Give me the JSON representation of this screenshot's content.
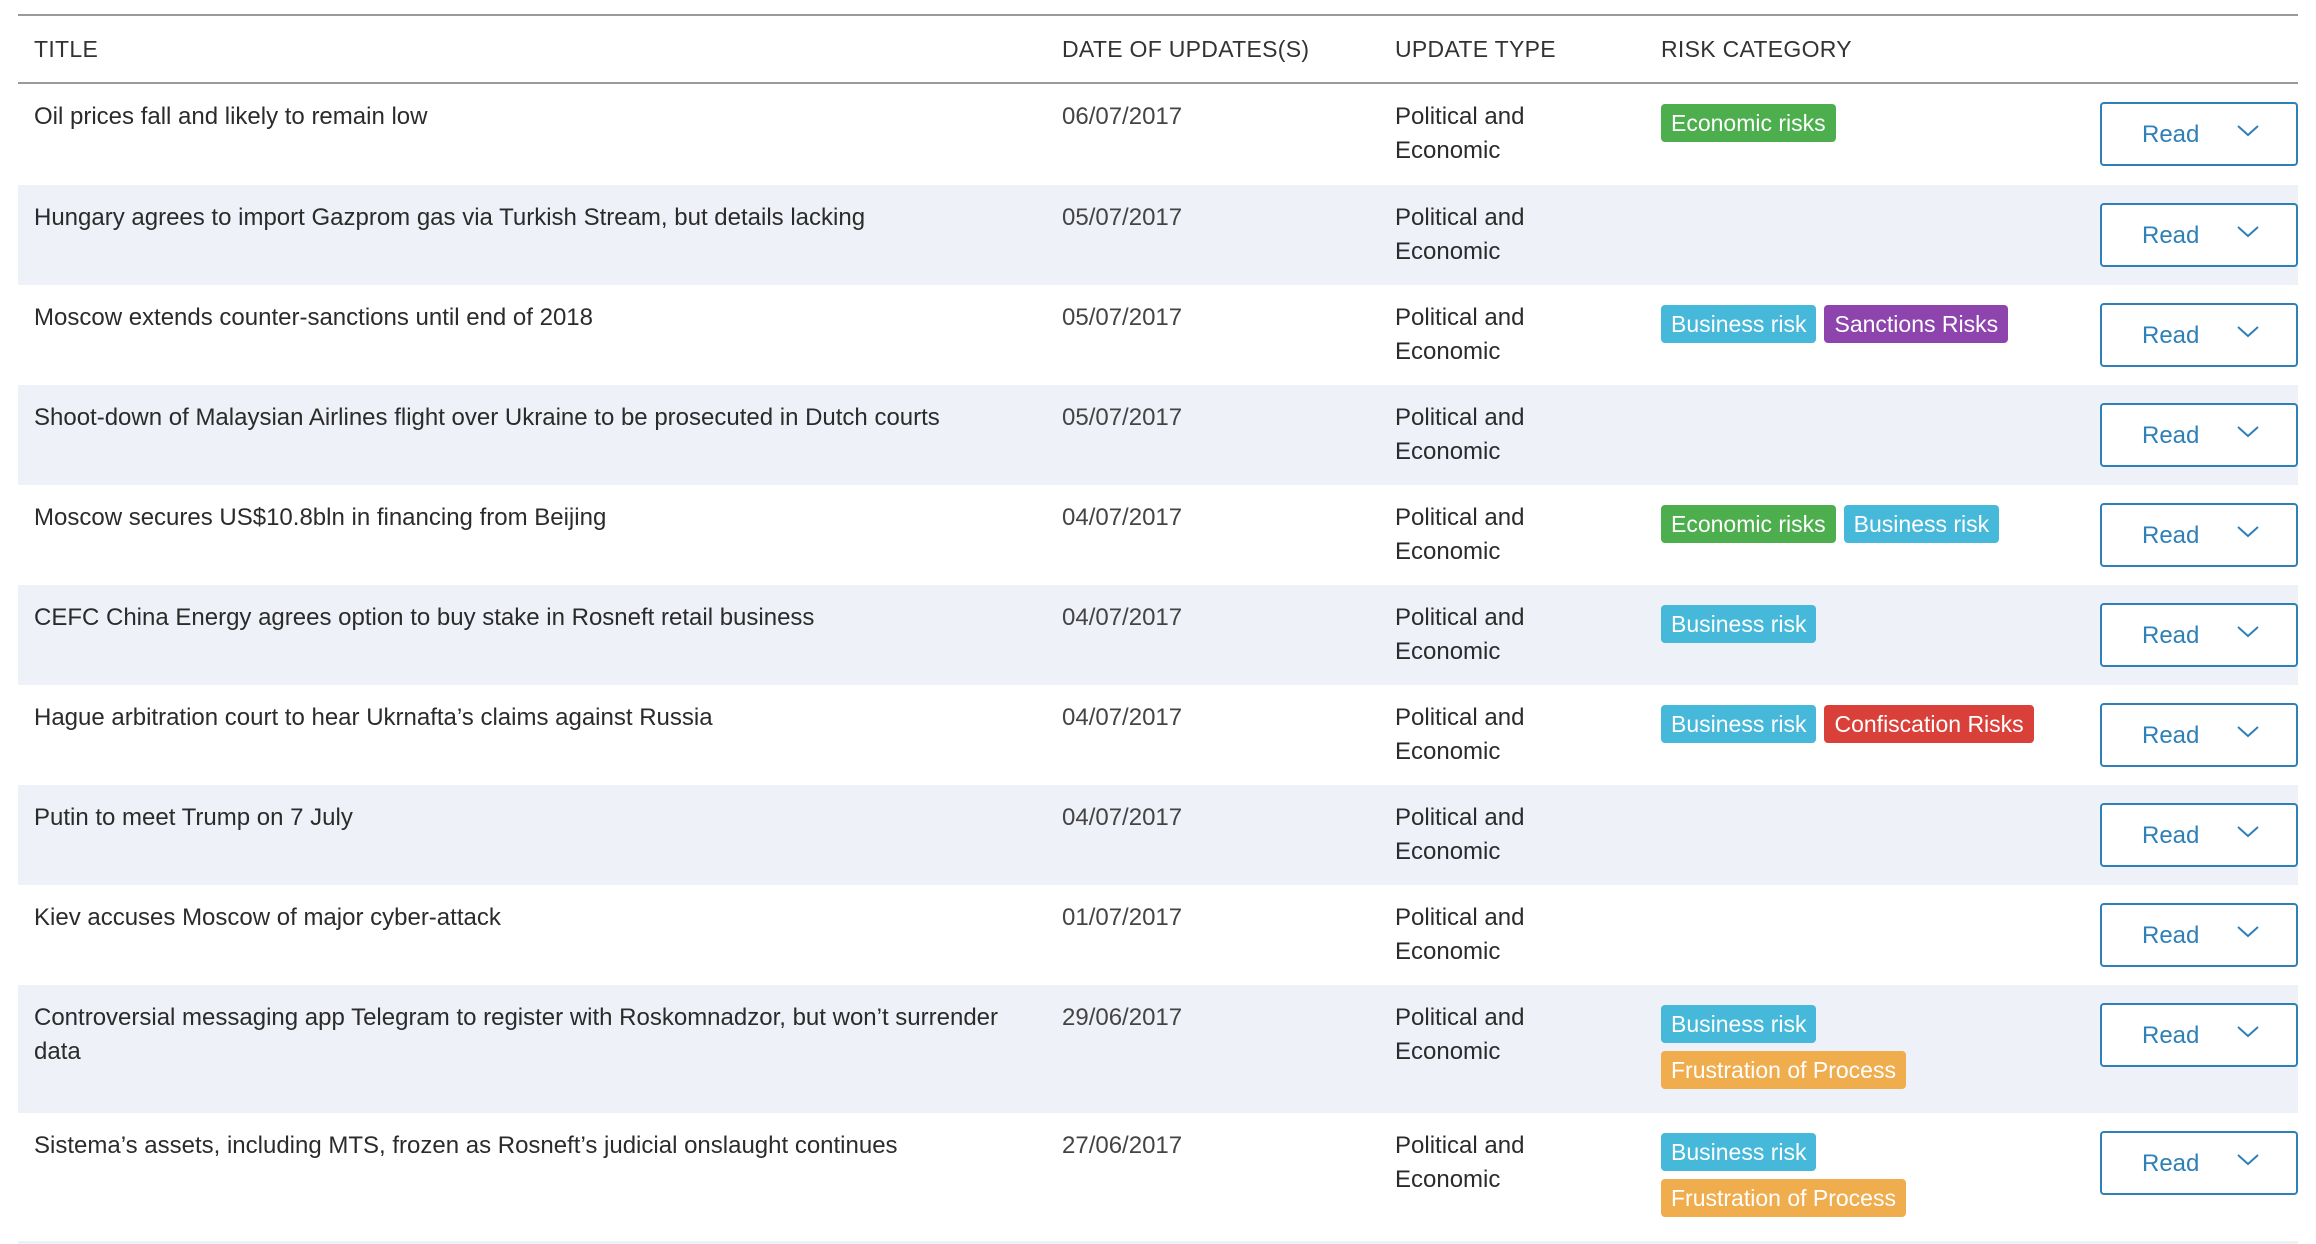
{
  "headers": {
    "title": "TITLE",
    "date": "DATE OF UPDATES(S)",
    "type": "UPDATE TYPE",
    "risk": "RISK CATEGORY"
  },
  "read_label": "Read",
  "tag_colors": {
    "Economic risks": "#4cae4c",
    "Business risk": "#46b8da",
    "Sanctions Risks": "#8e44ad",
    "Confiscation Risks": "#d9403a",
    "Frustration of Process": "#f0ad4e"
  },
  "rows": [
    {
      "title": "Oil prices fall and likely to remain low",
      "date": "06/07/2017",
      "type": "Political and Economic",
      "tags": [
        "Economic risks"
      ]
    },
    {
      "title": "Hungary agrees to import Gazprom gas via Turkish Stream, but details lacking",
      "date": "05/07/2017",
      "type": "Political and Economic",
      "tags": []
    },
    {
      "title": "Moscow extends counter-sanctions until end of 2018",
      "date": "05/07/2017",
      "type": "Political and Economic",
      "tags": [
        "Business risk",
        "Sanctions Risks"
      ]
    },
    {
      "title": "Shoot-down of Malaysian Airlines flight over Ukraine to be prosecuted in Dutch courts",
      "date": "05/07/2017",
      "type": "Political and Economic",
      "tags": []
    },
    {
      "title": "Moscow secures US$10.8bln in financing from Beijing",
      "date": "04/07/2017",
      "type": "Political and Economic",
      "tags": [
        "Economic risks",
        "Business risk"
      ]
    },
    {
      "title": "CEFC China Energy agrees option to buy stake in Rosneft retail business",
      "date": "04/07/2017",
      "type": "Political and Economic",
      "tags": [
        "Business risk"
      ]
    },
    {
      "title": "Hague arbitration court to hear Ukrnafta’s claims against Russia",
      "date": "04/07/2017",
      "type": "Political and Economic",
      "tags": [
        "Business risk",
        "Confiscation Risks"
      ]
    },
    {
      "title": "Putin to meet Trump on 7 July",
      "date": "04/07/2017",
      "type": "Political and Economic",
      "tags": []
    },
    {
      "title": "Kiev accuses Moscow of major cyber-attack",
      "date": "01/07/2017",
      "type": "Political and Economic",
      "tags": []
    },
    {
      "title": "Controversial messaging app Telegram to register with Roskomnadzor, but won’t surrender data",
      "date": "29/06/2017",
      "type": "Political and Economic",
      "tags": [
        "Business risk",
        "Frustration of Process"
      ]
    },
    {
      "title": "Sistema’s assets, including MTS, frozen as Rosneft’s judicial onslaught continues",
      "date": "27/06/2017",
      "type": "Political and Economic",
      "tags": [
        "Business risk",
        "Frustration of Process"
      ]
    }
  ]
}
